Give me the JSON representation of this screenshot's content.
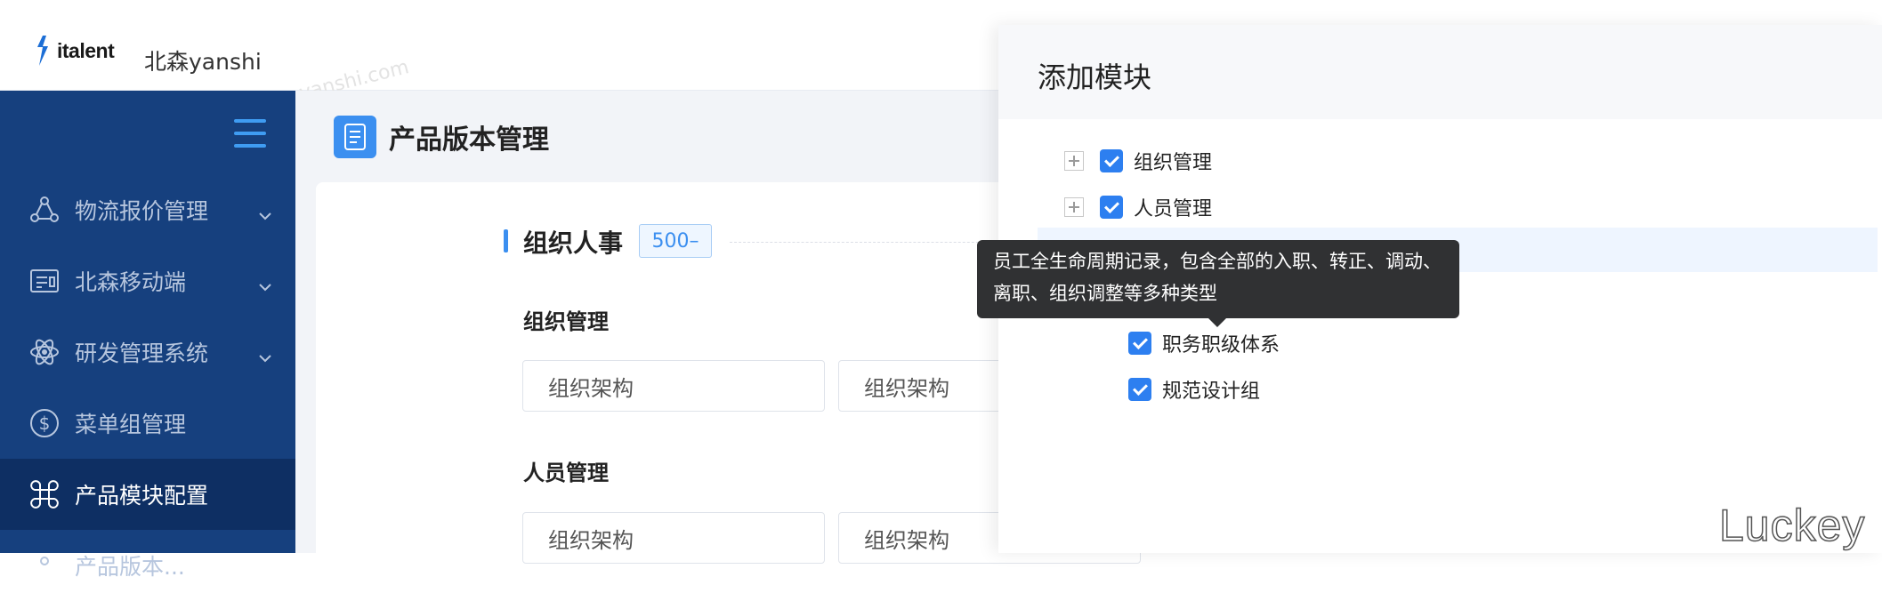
{
  "header": {
    "logo_text": "italent",
    "company": "北森yanshi",
    "watermark": "yanshi.com"
  },
  "sidebar": {
    "items": [
      {
        "label": "物流报价管理",
        "icon": "nodes-icon",
        "has_chevron": true
      },
      {
        "label": "北森移动端",
        "icon": "id-card-icon",
        "has_chevron": true
      },
      {
        "label": "研发管理系统",
        "icon": "atom-icon",
        "has_chevron": true
      },
      {
        "label": "菜单组管理",
        "icon": "dollar-icon",
        "has_chevron": false
      },
      {
        "label": "产品模块配置",
        "icon": "command-icon",
        "has_chevron": false,
        "active": true
      },
      {
        "label": "产品版本...",
        "icon": "partial-icon",
        "has_chevron": false
      }
    ]
  },
  "main": {
    "page_title": "产品版本管理",
    "section": {
      "title": "组织人事",
      "badge": "500–"
    },
    "groups": [
      {
        "title": "组织管理",
        "fields": [
          "组织架构",
          "组织架构"
        ]
      },
      {
        "title": "人员管理",
        "fields": [
          "组织架构",
          "组织架构"
        ]
      }
    ]
  },
  "drawer": {
    "title": "添加模块",
    "tree": [
      {
        "label": "组织管理",
        "checked": true,
        "expandable": true
      },
      {
        "label": "人员管理",
        "checked": true,
        "expandable": true
      },
      {
        "label": "职务职级体系",
        "checked": true,
        "expandable": false
      },
      {
        "label": "规范设计组",
        "checked": true,
        "expandable": false
      }
    ],
    "tooltip": "员工全生命周期记录，包含全部的入职、转正、调动、离职、组织调整等多种类型"
  },
  "brand_watermark": "Luckey",
  "colors": {
    "sidebar_bg": "#16407e",
    "sidebar_active": "#0e2f63",
    "accent": "#3b8ff0",
    "checkbox": "#2d7ff0"
  }
}
